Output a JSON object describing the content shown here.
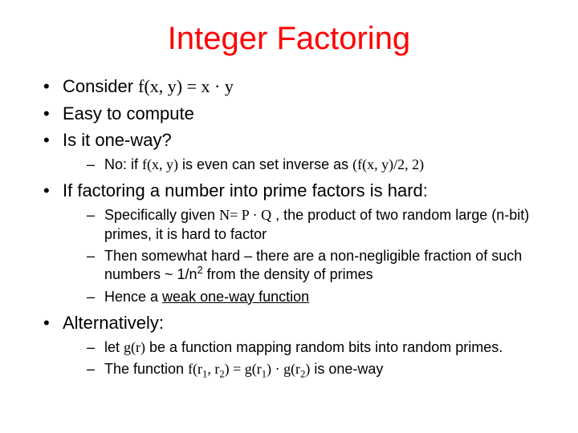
{
  "title": "Integer Factoring",
  "b1": {
    "pre": "Consider ",
    "expr": "f(x, y) = x · y"
  },
  "b2": "Easy to compute",
  "b3": "Is it one-way?",
  "b3s1": {
    "pre": "No: if ",
    "e1": "f(x, y)",
    "mid": " is even can set inverse as ",
    "e2": "(f(x, y)/2, 2)"
  },
  "b4": "If factoring a number into prime factors is hard:",
  "b4s1": {
    "pre": "Specifically given ",
    "e1": "N= P · Q",
    "post": " , the product of two random large (n-bit) primes, it is hard to factor"
  },
  "b4s2": {
    "pre": "Then somewhat hard – there are a non-negligible fraction of such numbers  ~ 1/n",
    "exp": "2",
    "post": "  from the density of primes"
  },
  "b4s3": {
    "pre": "Hence a ",
    "u": "weak one-way function"
  },
  "b5": "Alternatively:",
  "b5s1": {
    "pre": "let ",
    "e1": "g(r)",
    "post": " be a function mapping random bits into random primes."
  },
  "b5s2": {
    "pre": "The function ",
    "e1a": "f(r",
    "s1": "1",
    "e1b": ", r",
    "s2": "2",
    "e1c": ") = g(r",
    "s3": "1",
    "e1d": ") · g(r",
    "s4": "2",
    "e1e": ")",
    "post": " is one-way"
  }
}
